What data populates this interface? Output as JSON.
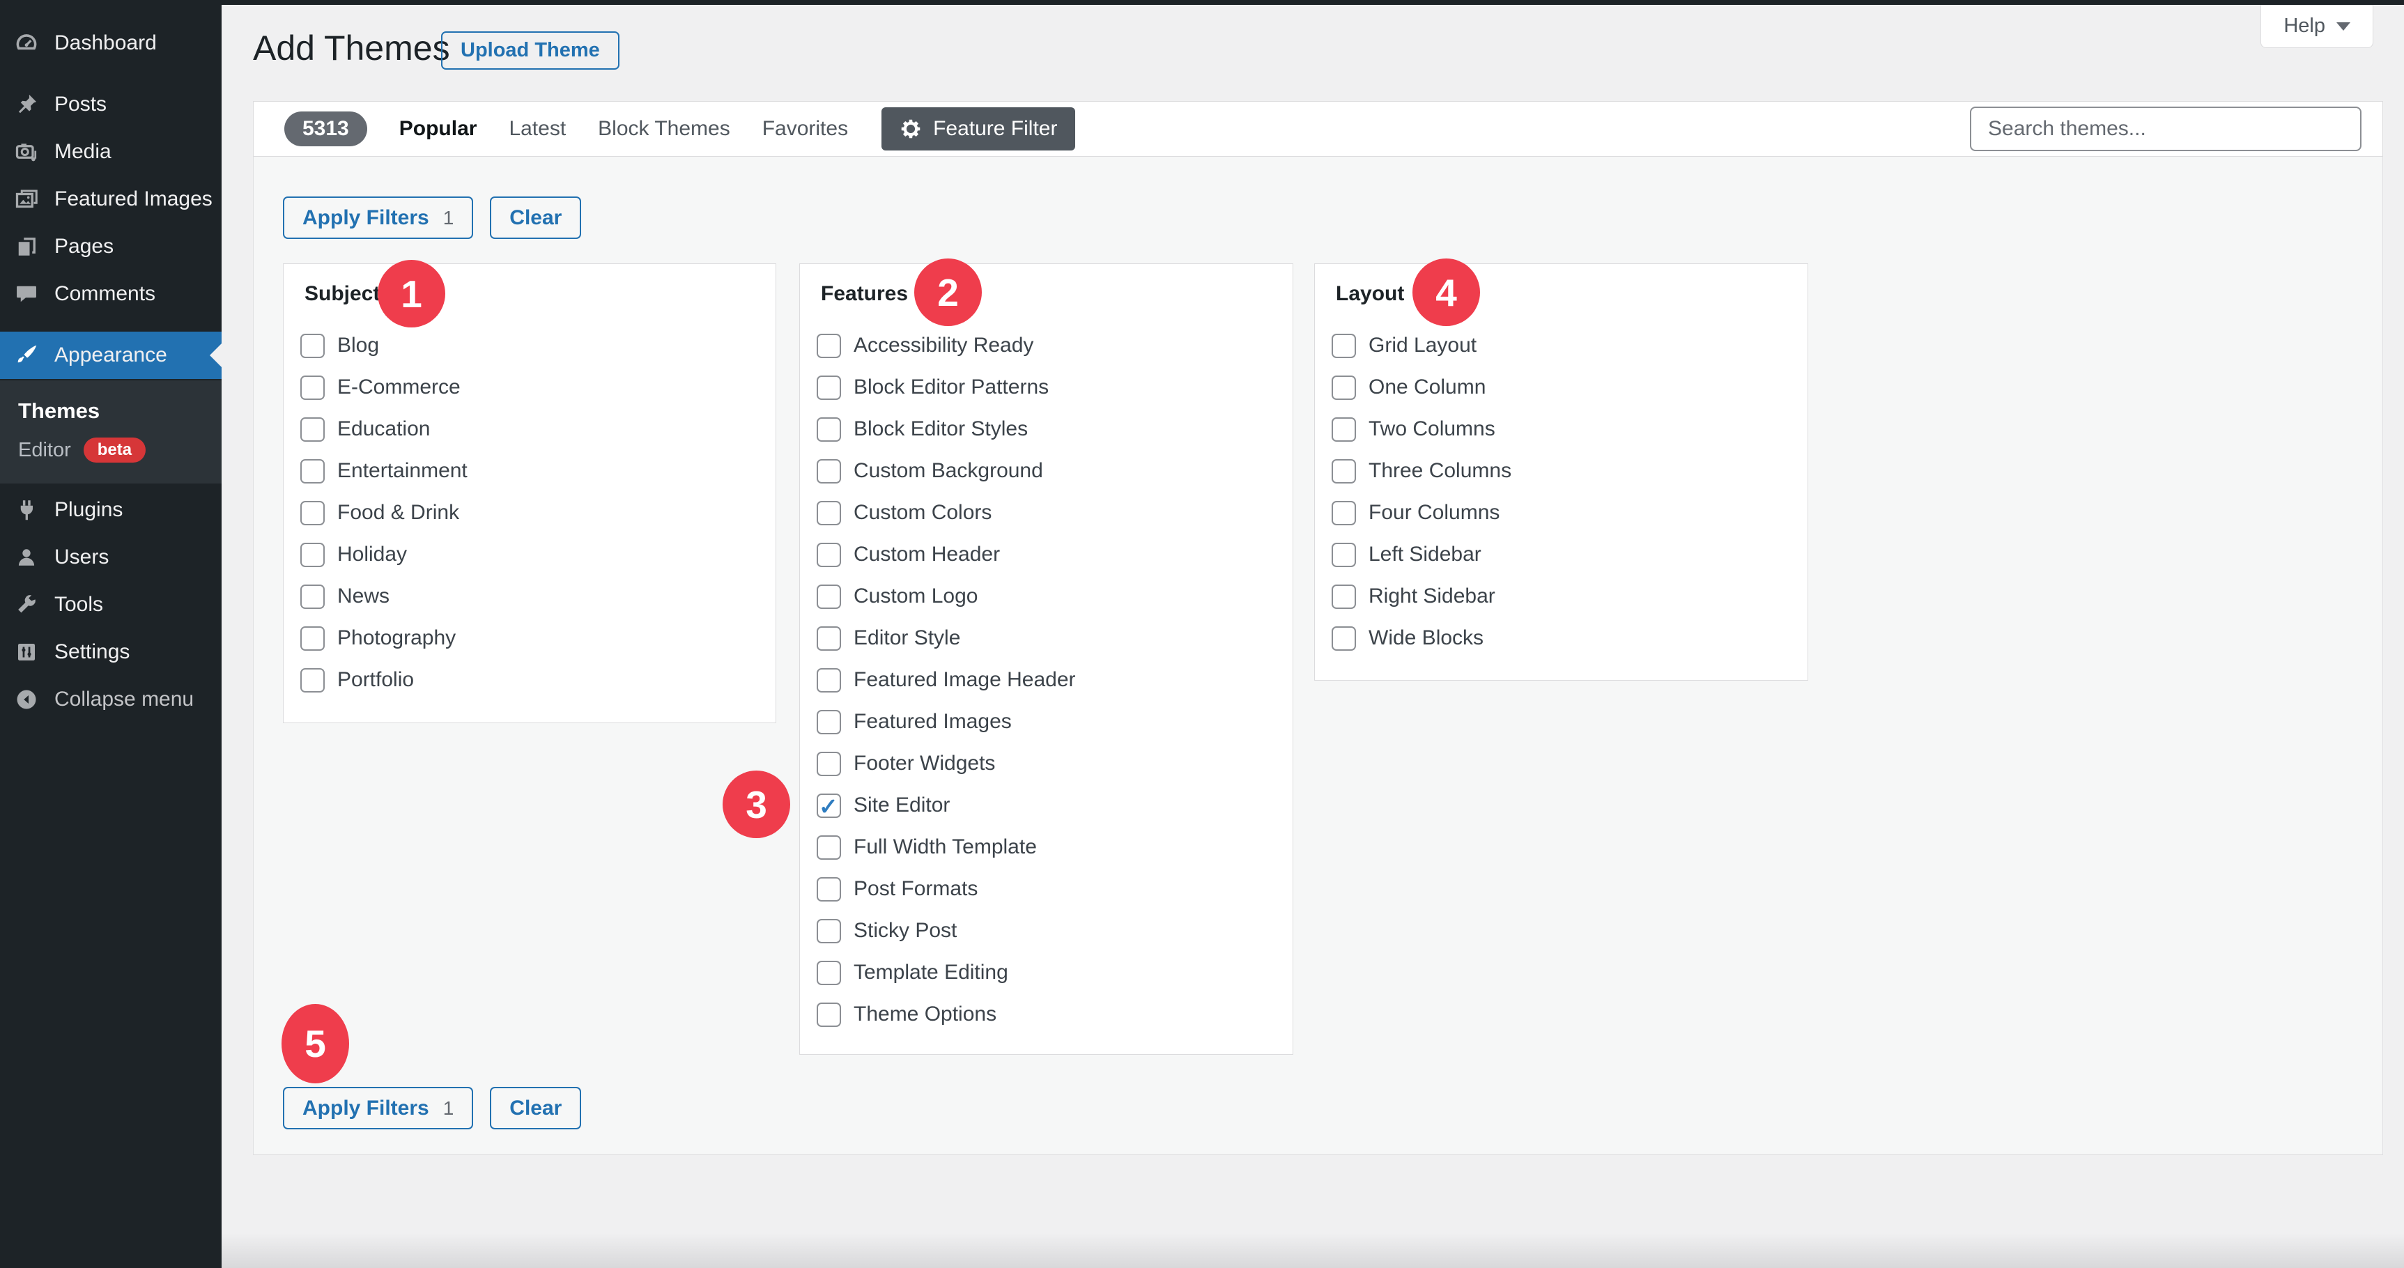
{
  "colors": {
    "accent_blue": "#2271b1",
    "sidebar_bg": "#1d2327",
    "sidebar_submenu_bg": "#2c3338",
    "badge_red": "#d63638",
    "step_marker_red": "#ef3d4c",
    "feature_filter_button": "#50575e",
    "count_pill_gray": "#646970",
    "page_bg": "#f0f0f1",
    "drawer_bg": "#f6f7f7",
    "panel_border": "#dcdcde",
    "checkbox_check_blue": "#2e7cc0"
  },
  "sidebar": {
    "items": [
      {
        "label": "Dashboard",
        "icon": "dashboard-icon"
      },
      {
        "label": "Posts",
        "icon": "pushpin-icon"
      },
      {
        "label": "Media",
        "icon": "media-icon"
      },
      {
        "label": "Featured Images",
        "icon": "featured-images-icon"
      },
      {
        "label": "Pages",
        "icon": "pages-icon"
      },
      {
        "label": "Comments",
        "icon": "comments-icon"
      },
      {
        "label": "Appearance",
        "icon": "appearance-icon",
        "active": true
      }
    ],
    "submenu": {
      "title": "Themes",
      "items": [
        {
          "label": "Editor",
          "badge": "beta"
        }
      ]
    },
    "lower_items": [
      {
        "label": "Plugins",
        "icon": "plugin-icon"
      },
      {
        "label": "Users",
        "icon": "users-icon"
      },
      {
        "label": "Tools",
        "icon": "tools-icon"
      },
      {
        "label": "Settings",
        "icon": "settings-icon"
      }
    ],
    "collapse": {
      "label": "Collapse menu",
      "icon": "collapse-icon"
    }
  },
  "header": {
    "title": "Add Themes",
    "upload_button": "Upload Theme",
    "help": {
      "label": "Help"
    }
  },
  "filter_bar": {
    "count": "5313",
    "tabs": [
      {
        "label": "Popular",
        "active": true
      },
      {
        "label": "Latest",
        "active": false
      },
      {
        "label": "Block Themes",
        "active": false
      },
      {
        "label": "Favorites",
        "active": false
      }
    ],
    "feature_filter": {
      "label": "Feature Filter",
      "icon": "gear-icon"
    },
    "search": {
      "placeholder": "Search themes..."
    }
  },
  "drawer": {
    "apply_button": {
      "label": "Apply Filters",
      "count": "1"
    },
    "clear_button": {
      "label": "Clear"
    },
    "groups": [
      {
        "title": "Subject",
        "options": [
          {
            "label": "Blog",
            "checked": false
          },
          {
            "label": "E-Commerce",
            "checked": false
          },
          {
            "label": "Education",
            "checked": false
          },
          {
            "label": "Entertainment",
            "checked": false
          },
          {
            "label": "Food & Drink",
            "checked": false
          },
          {
            "label": "Holiday",
            "checked": false
          },
          {
            "label": "News",
            "checked": false
          },
          {
            "label": "Photography",
            "checked": false
          },
          {
            "label": "Portfolio",
            "checked": false
          }
        ]
      },
      {
        "title": "Features",
        "options": [
          {
            "label": "Accessibility Ready",
            "checked": false
          },
          {
            "label": "Block Editor Patterns",
            "checked": false
          },
          {
            "label": "Block Editor Styles",
            "checked": false
          },
          {
            "label": "Custom Background",
            "checked": false
          },
          {
            "label": "Custom Colors",
            "checked": false
          },
          {
            "label": "Custom Header",
            "checked": false
          },
          {
            "label": "Custom Logo",
            "checked": false
          },
          {
            "label": "Editor Style",
            "checked": false
          },
          {
            "label": "Featured Image Header",
            "checked": false
          },
          {
            "label": "Featured Images",
            "checked": false
          },
          {
            "label": "Footer Widgets",
            "checked": false
          },
          {
            "label": "Site Editor",
            "checked": true
          },
          {
            "label": "Full Width Template",
            "checked": false
          },
          {
            "label": "Post Formats",
            "checked": false
          },
          {
            "label": "Sticky Post",
            "checked": false
          },
          {
            "label": "Template Editing",
            "checked": false
          },
          {
            "label": "Theme Options",
            "checked": false
          }
        ]
      },
      {
        "title": "Layout",
        "options": [
          {
            "label": "Grid Layout",
            "checked": false
          },
          {
            "label": "One Column",
            "checked": false
          },
          {
            "label": "Two Columns",
            "checked": false
          },
          {
            "label": "Three Columns",
            "checked": false
          },
          {
            "label": "Four Columns",
            "checked": false
          },
          {
            "label": "Left Sidebar",
            "checked": false
          },
          {
            "label": "Right Sidebar",
            "checked": false
          },
          {
            "label": "Wide Blocks",
            "checked": false
          }
        ]
      }
    ],
    "step_markers": [
      {
        "number": "1"
      },
      {
        "number": "2"
      },
      {
        "number": "3"
      },
      {
        "number": "4"
      },
      {
        "number": "5"
      }
    ]
  }
}
